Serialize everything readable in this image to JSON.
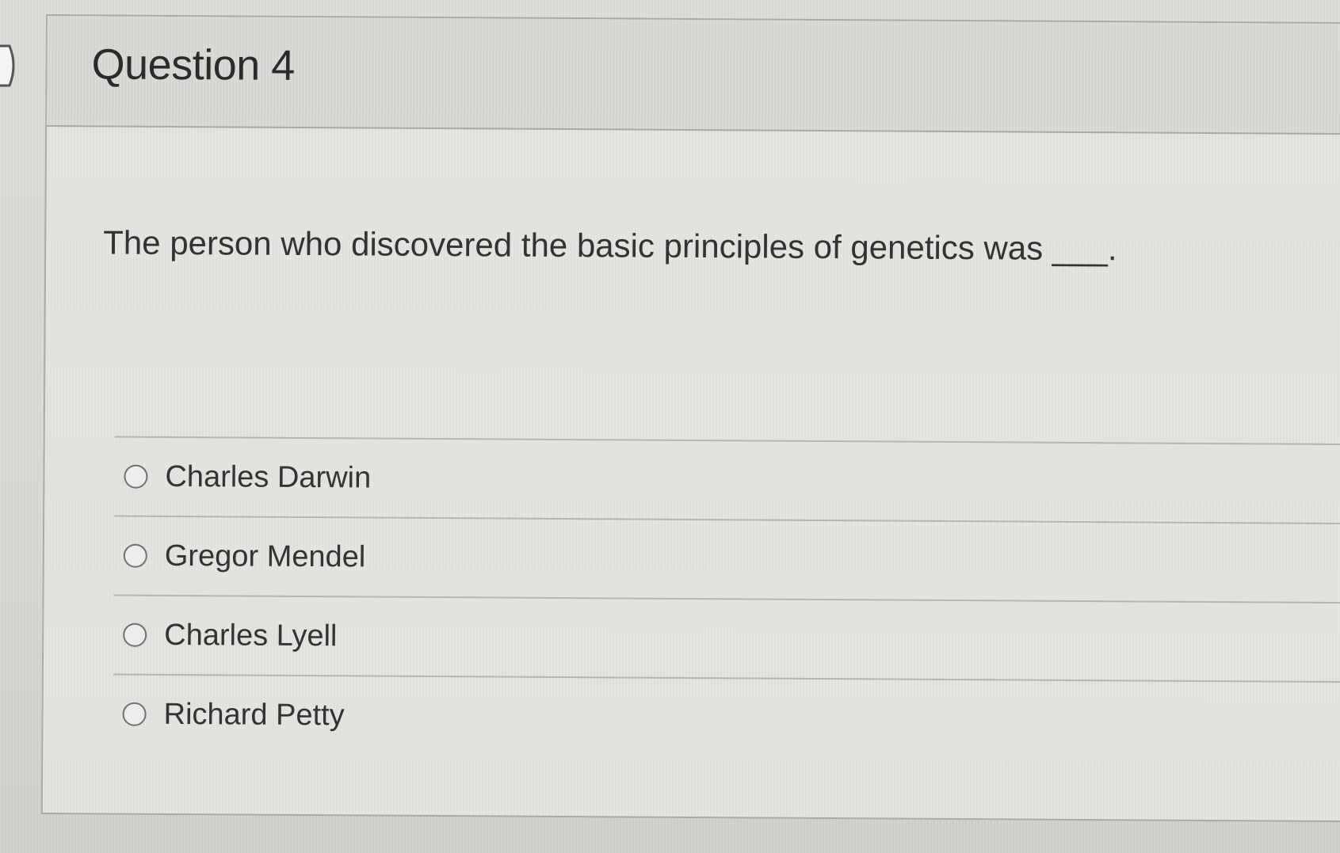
{
  "question": {
    "title": "Question 4",
    "prompt": "The person who discovered the basic principles of genetics was ___.",
    "options": [
      {
        "label": "Charles Darwin",
        "selected": false
      },
      {
        "label": "Gregor Mendel",
        "selected": false
      },
      {
        "label": "Charles Lyell",
        "selected": false
      },
      {
        "label": "Richard Petty",
        "selected": false
      }
    ]
  },
  "icons": {
    "nav": "chevron-right-icon",
    "radio": "radio-unselected-icon"
  },
  "colors": {
    "background": "#d6d6d2",
    "card": "#e3e3df",
    "border": "#a9a9a5",
    "text": "#2d2d2d"
  }
}
